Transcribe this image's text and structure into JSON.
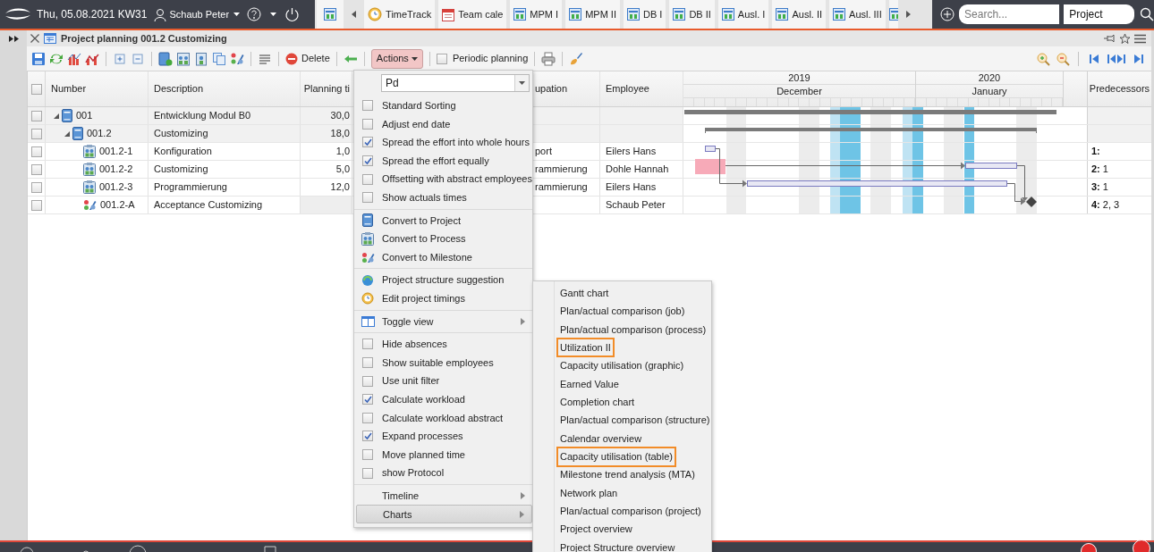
{
  "top_bar": {
    "date": "Thu, 05.08.2021 KW31",
    "user": "Schaub Peter",
    "tabs": [
      {
        "label": "TimeTrack"
      },
      {
        "label": "Team cale"
      },
      {
        "label": "MPM I"
      },
      {
        "label": "MPM II"
      },
      {
        "label": "DB I"
      },
      {
        "label": "DB II"
      },
      {
        "label": "Ausl. I"
      },
      {
        "label": "Ausl. II"
      },
      {
        "label": "Ausl. III"
      }
    ],
    "search": {
      "placeholder": "Search..."
    },
    "scope": "Project"
  },
  "window": {
    "title": "Project planning 001.2 Customizing"
  },
  "toolbar": {
    "delete": "Delete",
    "actions": {
      "label": "Actions",
      "pressed": true
    },
    "periodic": {
      "label": "Periodic planning",
      "checked": false
    }
  },
  "table": {
    "header_checked": false,
    "columns": [
      "Number",
      "Description",
      "Planning ti",
      "upation",
      "Employee",
      "Predecessors"
    ],
    "rows": [
      {
        "kind": "project",
        "number": "001",
        "description": "Entwicklung Modul B0",
        "planning": "30,0",
        "checked": false,
        "expanded": true,
        "children": [
          {
            "kind": "project",
            "number": "001.2",
            "description": "Customizing",
            "planning": "18,0",
            "checked": false,
            "expanded": true,
            "children": [
              {
                "kind": "process",
                "number": "001.2-1",
                "description": "Konfiguration",
                "planning": "1,0",
                "occupation": "port",
                "employee": "Eilers Hans",
                "predecessors": "**1:**",
                "checked": false
              },
              {
                "kind": "process",
                "number": "001.2-2",
                "description": "Customizing",
                "planning": "5,0",
                "occupation": "rammierung",
                "employee": "Dohle Hannah",
                "predecessors": "**2:** 1",
                "checked": false
              },
              {
                "kind": "process",
                "number": "001.2-3",
                "description": "Programmierung",
                "planning": "12,0",
                "occupation": "rammierung",
                "employee": "Eilers Hans",
                "predecessors": "**3:** 1",
                "checked": false
              },
              {
                "kind": "milestone",
                "number": "001.2-A",
                "description": "Acceptance Customizing",
                "employee": "Schaub Peter",
                "predecessors": "**4:** 2, 3",
                "checked": false
              }
            ]
          }
        ]
      }
    ]
  },
  "timeline": {
    "years": [
      {
        "year": "2019",
        "month": "December"
      },
      {
        "year": "2020",
        "month": "January"
      }
    ]
  },
  "actions_menu": {
    "field": {
      "value": "Pd"
    },
    "groups": [
      {
        "items": [
          {
            "kind": "checkbox",
            "label": "Standard Sorting",
            "checked": false
          },
          {
            "kind": "checkbox",
            "label": "Adjust end date",
            "checked": false
          },
          {
            "kind": "checkbox",
            "label": "Spread the effort into whole hours",
            "checked": true
          },
          {
            "kind": "checkbox",
            "label": "Spread the effort equally",
            "checked": true
          },
          {
            "kind": "checkbox",
            "label": "Offsetting with abstract employees",
            "checked": false
          },
          {
            "kind": "checkbox",
            "label": "Show actuals times",
            "checked": false
          }
        ]
      },
      {
        "items": [
          {
            "kind": "action",
            "label": "Convert to Project"
          },
          {
            "kind": "action",
            "label": "Convert to Process"
          },
          {
            "kind": "action",
            "label": "Convert to Milestone"
          }
        ]
      },
      {
        "items": [
          {
            "kind": "action",
            "label": "Project structure suggestion"
          },
          {
            "kind": "action",
            "label": "Edit project timings"
          }
        ]
      },
      {
        "items": [
          {
            "kind": "view_toggle",
            "label": "Toggle view",
            "selected": false
          }
        ]
      },
      {
        "items": [
          {
            "kind": "checkbox",
            "label": "Hide absences",
            "checked": false
          },
          {
            "kind": "checkbox",
            "label": "Show suitable employees",
            "checked": false
          },
          {
            "kind": "checkbox",
            "label": "Use unit filter",
            "checked": false
          },
          {
            "kind": "checkbox",
            "label": "Calculate workload",
            "checked": true
          },
          {
            "kind": "checkbox",
            "label": "Calculate workload abstract",
            "checked": false
          },
          {
            "kind": "checkbox",
            "label": "Expand processes",
            "checked": true
          },
          {
            "kind": "checkbox",
            "label": "Move planned time",
            "checked": false
          },
          {
            "kind": "checkbox",
            "label": "show Protocol",
            "checked": false
          }
        ]
      },
      {
        "items": [
          {
            "kind": "submenu",
            "label": "Timeline",
            "selected": false
          },
          {
            "kind": "submenu",
            "label": "Charts",
            "selected": true
          }
        ]
      }
    ]
  },
  "charts_submenu": {
    "items": [
      {
        "label": "Gantt chart",
        "highlighted": false
      },
      {
        "label": "Plan/actual comparison (job)",
        "highlighted": false
      },
      {
        "label": "Plan/actual comparison (process)",
        "highlighted": false
      },
      {
        "label": "Utilization II",
        "highlighted": true
      },
      {
        "label": "Capacity utilisation (graphic)",
        "highlighted": false
      },
      {
        "label": "Earned Value",
        "highlighted": false
      },
      {
        "label": "Completion chart",
        "highlighted": false
      },
      {
        "label": "Plan/actual comparison (structure)",
        "highlighted": false
      },
      {
        "label": "Calendar overview",
        "highlighted": false
      },
      {
        "label": "Capacity utilisation (table)",
        "highlighted": true
      },
      {
        "label": "Milestone trend analysis (MTA)",
        "highlighted": false
      },
      {
        "label": "Network plan",
        "highlighted": false
      },
      {
        "label": "Plan/actual comparison (project)",
        "highlighted": false
      },
      {
        "label": "Project overview",
        "highlighted": false
      },
      {
        "label": "Project Structure overview",
        "highlighted": false
      }
    ]
  }
}
